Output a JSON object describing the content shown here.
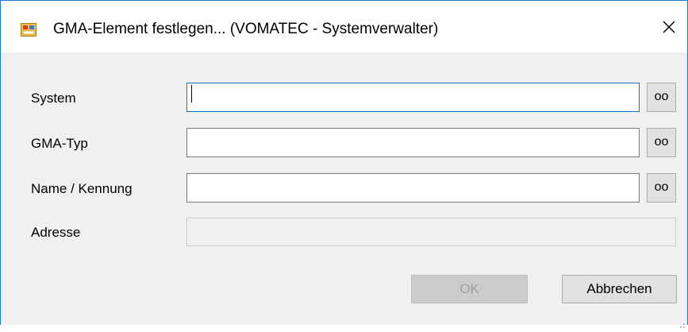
{
  "window": {
    "title": "GMA-Element festlegen... (VOMATEC -  Systemverwalter)",
    "close_icon": "close-icon",
    "app_icon": "app-icon"
  },
  "form": {
    "system_label": "System",
    "system_value": "",
    "gma_typ_label": "GMA-Typ",
    "gma_typ_value": "",
    "name_label": "Name / Kennung",
    "name_value": "",
    "adresse_label": "Adresse",
    "adresse_value": "",
    "lookup_button_label": "oo"
  },
  "buttons": {
    "ok_label": "OK",
    "cancel_label": "Abbrechen"
  },
  "colors": {
    "window_border": "#1b79d3",
    "focus_border": "#1c6fc9",
    "client_background": "#f0f0f0"
  }
}
